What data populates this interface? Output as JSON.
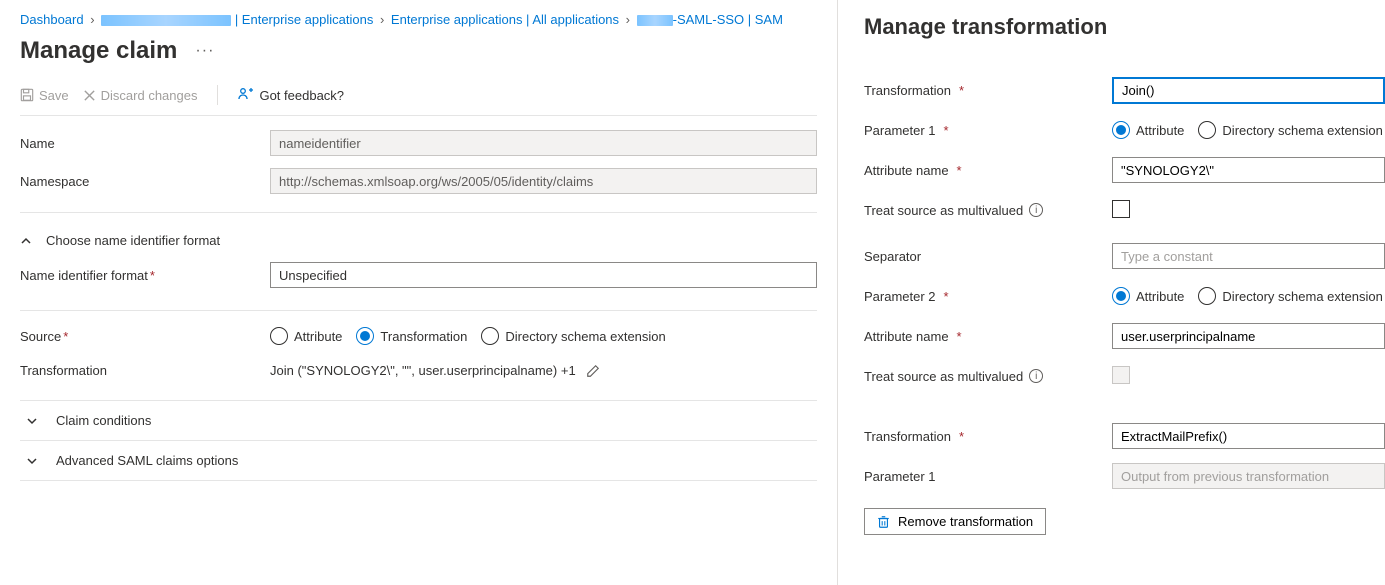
{
  "breadcrumb": {
    "dashboard": "Dashboard",
    "ent_apps_label": " | Enterprise applications",
    "all_apps": "Enterprise applications | All applications",
    "app_suffix": "-SAML-SSO | SAM"
  },
  "page": {
    "title": "Manage claim",
    "more": "···"
  },
  "toolbar": {
    "save": "Save",
    "discard": "Discard changes",
    "feedback": "Got feedback?"
  },
  "form": {
    "name_label": "Name",
    "name_value": "nameidentifier",
    "namespace_label": "Namespace",
    "namespace_value": "http://schemas.xmlsoap.org/ws/2005/05/identity/claims",
    "choose_format": "Choose name identifier format",
    "nif_label": "Name identifier format",
    "nif_value": "Unspecified",
    "source_label": "Source",
    "source_options": {
      "attribute": "Attribute",
      "transformation": "Transformation",
      "dse": "Directory schema extension"
    },
    "transformation_label": "Transformation",
    "transformation_text": "Join (\"SYNOLOGY2\\\", \"\", user.userprincipalname) +1",
    "claim_conditions": "Claim conditions",
    "advanced_saml": "Advanced SAML claims options"
  },
  "right": {
    "title": "Manage transformation",
    "transformation_label": "Transformation",
    "transformation_value": "Join()",
    "param1_label": "Parameter 1",
    "radio_attribute": "Attribute",
    "radio_dse": "Directory schema extension",
    "attr_name_label": "Attribute name",
    "attr_name_value1": "\"SYNOLOGY2\\\"",
    "treat_multi": "Treat source as multivalued",
    "separator_label": "Separator",
    "separator_placeholder": "Type a constant",
    "param2_label": "Parameter 2",
    "attr_name_value2": "user.userprincipalname",
    "transformation2_value": "ExtractMailPrefix()",
    "param1b_label": "Parameter 1",
    "param1b_placeholder": "Output from previous transformation",
    "remove_btn": "Remove transformation"
  }
}
